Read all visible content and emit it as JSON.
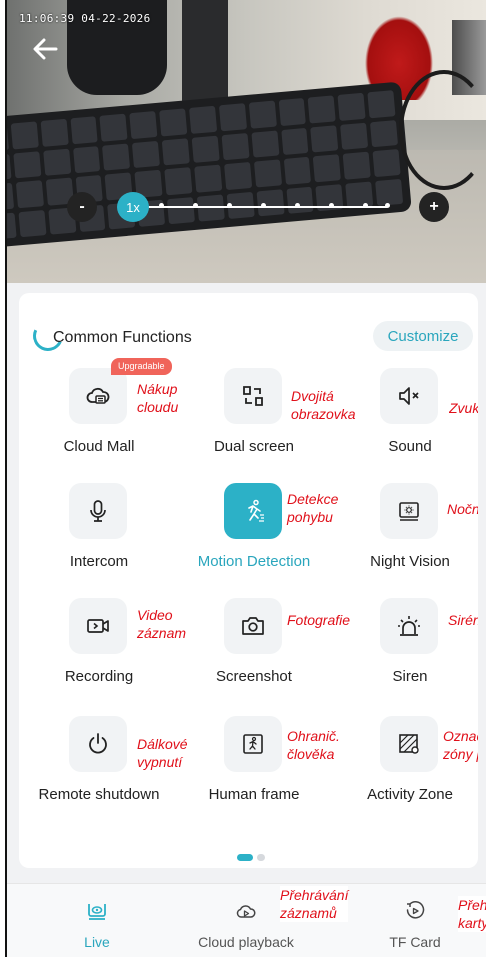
{
  "video": {
    "timestamp": "11:06:39 04-22-2026",
    "zoom": {
      "minus_label": "-",
      "plus_label": "+",
      "level_label": "1x"
    }
  },
  "common_functions": {
    "title": "Common Functions",
    "customize_label": "Customize",
    "items": [
      {
        "label": "Cloud Mall",
        "icon": "cloud-mall-icon",
        "badge": "Upgradable",
        "annotation": [
          "Nákup",
          "cloudu"
        ]
      },
      {
        "label": "Dual screen",
        "icon": "dual-screen-icon",
        "annotation": [
          "Dvojitá",
          "obrazovka"
        ]
      },
      {
        "label": "Sound",
        "icon": "sound-muted-icon",
        "annotation": [
          "Zvuk"
        ]
      },
      {
        "label": "Intercom",
        "icon": "microphone-icon",
        "annotation": []
      },
      {
        "label": "Motion Detection",
        "icon": "running-person-icon",
        "active": true,
        "annotation": [
          "Detekce",
          "pohybu"
        ]
      },
      {
        "label": "Night Vision",
        "icon": "night-vision-icon",
        "annotation": [
          "Noční"
        ]
      },
      {
        "label": "Recording",
        "icon": "video-recording-icon",
        "annotation": [
          "Video",
          "záznam"
        ]
      },
      {
        "label": "Screenshot",
        "icon": "camera-icon",
        "annotation": [
          "Fotografie"
        ]
      },
      {
        "label": "Siren",
        "icon": "siren-icon",
        "annotation": [
          "Sirén"
        ]
      },
      {
        "label": "Remote shutdown",
        "icon": "power-icon",
        "annotation": [
          "Dálkové",
          "vypnutí"
        ]
      },
      {
        "label": "Human frame",
        "icon": "human-frame-icon",
        "annotation": [
          "Ohranič.",
          "člověka"
        ]
      },
      {
        "label": "Activity Zone",
        "icon": "activity-zone-icon",
        "annotation": [
          "Označ",
          "zóny p"
        ]
      }
    ],
    "pager": {
      "pages": 2,
      "current": 1
    }
  },
  "tabbar": {
    "tabs": [
      {
        "label": "Live",
        "icon": "live-camera-icon",
        "active": true
      },
      {
        "label": "Cloud playback",
        "icon": "cloud-playback-icon",
        "annotation": [
          "Přehrávání",
          "záznamů"
        ]
      },
      {
        "label": "TF Card",
        "icon": "tf-card-playback-icon",
        "annotation": [
          "Přeh",
          "karty"
        ]
      }
    ]
  },
  "colors": {
    "accent": "#2cb1c7",
    "badge": "#f0645a",
    "annotation": "#e0101a",
    "panel_bg": "#f1f2f4"
  }
}
